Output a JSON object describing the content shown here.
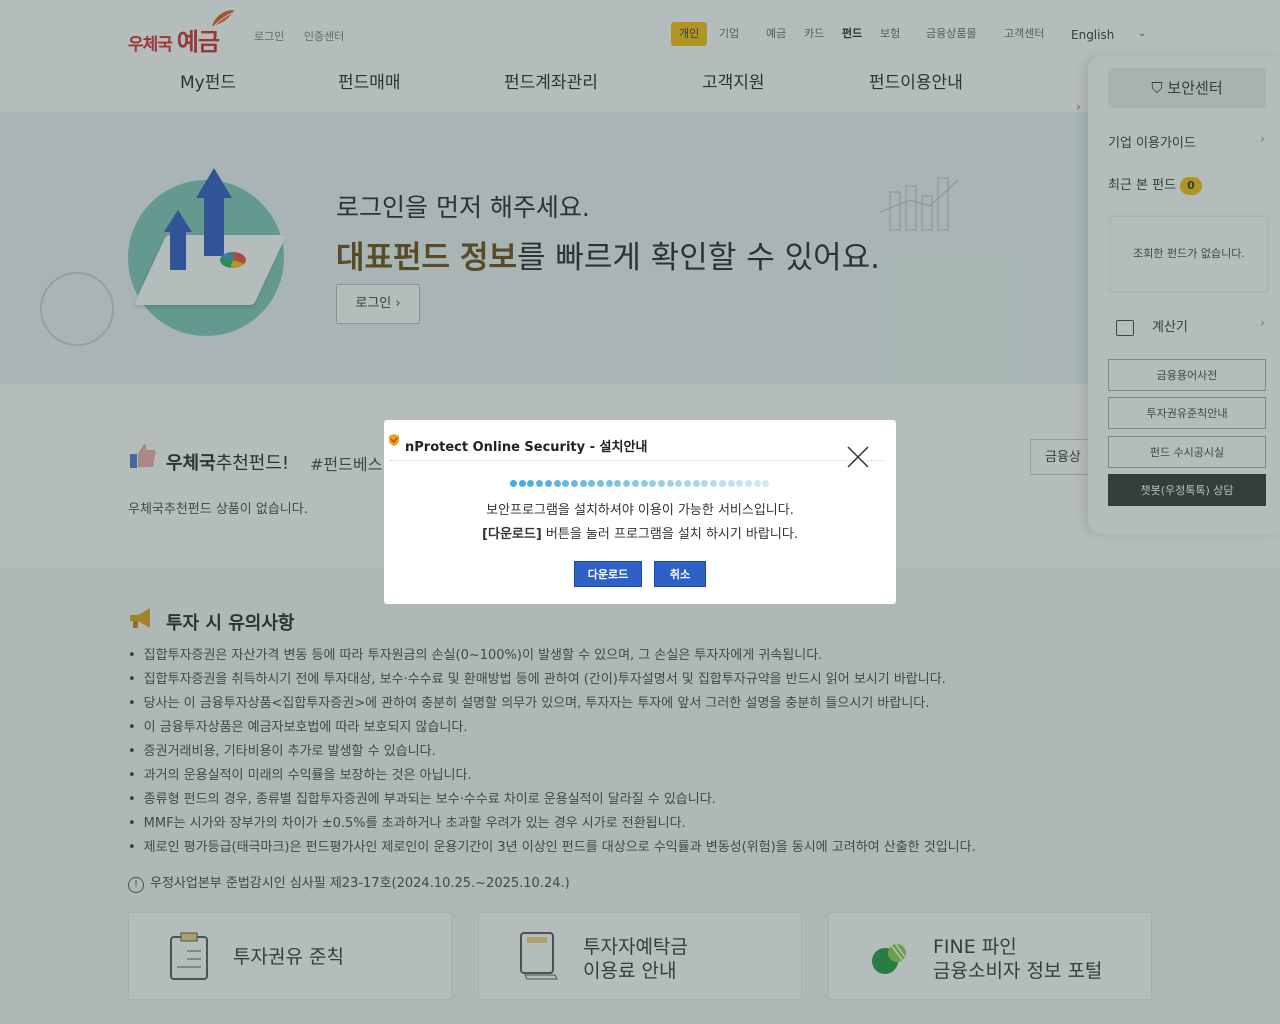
{
  "header": {
    "logo_text": "우체국",
    "logo_bold": "예금",
    "top_links": [
      "로그인",
      "인증센터"
    ],
    "segments": [
      "개인",
      "기업",
      "예금",
      "카드",
      "펀드",
      "보험",
      "금융상품몰",
      "고객센터"
    ],
    "active_segment": "개인",
    "language": "English",
    "accent": "#f7c10a"
  },
  "gnb": [
    "My펀드",
    "펀드매매",
    "펀드계좌관리",
    "고객지원",
    "펀드이용안내"
  ],
  "banner": {
    "line1": "로그인을 먼저 해주세요.",
    "line2_bold1": "대표펀드",
    "line2_bold2": "정보",
    "line2_rest": "를 빠르게 확인할 수 있어요.",
    "login_button": "로그인",
    "bg": "#eaf4f2"
  },
  "recommend": {
    "title_bold": "우체국",
    "title_rest": "추천펀드!",
    "hashtag": "#펀드베스",
    "empty_text": "우체국추천펀드 상품이 없습니다.",
    "side_button": "금융상품"
  },
  "notice": {
    "title": "투자 시 유의사항",
    "items": [
      "집합투자증권은 자산가격 변동 등에 따라 투자원금의 손실(0~100%)이 발생할 수 있으며, 그 손실은 투자자에게 귀속됩니다.",
      "집합투자증권을 취득하시기 전에 투자대상, 보수·수수료 및 환매방법 등에 관하여 (간이)투자설명서 및 집합투자규약을 반드시 읽어 보시기 바랍니다.",
      "당사는 이 금융투자상품<집합투자증권>에 관하여 충분히 설명할 의무가 있으며, 투자자는 투자에 앞서 그러한 설명을 충분히 들으시기 바랍니다.",
      "이 금융투자상품은 예금자보호법에 따라 보호되지 않습니다.",
      "증권거래비용, 기타비용이 추가로 발생할 수 있습니다.",
      "과거의 운용실적이 미래의 수익률을 보장하는 것은 아닙니다.",
      "종류형 펀드의 경우, 종류별 집합투자증권에 부과되는 보수·수수료 차이로 운용실적이 달라질 수 있습니다.",
      "MMF는 시가와 장부가의 차이가 ±0.5%를 초과하거나 초과할 우려가 있는 경우 시가로 전환됩니다.",
      "제로인 평가등급(태극마크)은 펀드평가사인 제로인이 운용기간이 3년 이상인 펀드를 대상으로 수익률과 변동성(위험)을 동시에 고려하여 산출한 것입니다."
    ],
    "review_icon": "!",
    "review": "우정사업본부 준법감시인 심사필 제23-17호(2024.10.25.~2025.10.24.)"
  },
  "cards": [
    {
      "line1": "투자권유 준칙",
      "line2": "",
      "icon": "clipboard-icon"
    },
    {
      "line1": "투자자예탁금",
      "line2": "이용료 안내",
      "icon": "document-icon"
    },
    {
      "line1": "FINE 파인",
      "line2": "금융소비자 정보 포털",
      "icon": "fine-logo-icon"
    }
  ],
  "quick": {
    "security": "보안센터",
    "guide": "기업 이용가이드",
    "recent": "최근 본 펀드",
    "recent_count": "0",
    "recent_empty": "조회한 펀드가 없습니다.",
    "calculator": "계산기",
    "buttons": [
      "금융용어사전",
      "투자권유준칙안내",
      "펀드 수시공시실"
    ],
    "chat_button": "챗봇(우정톡톡) 상담"
  },
  "modal": {
    "title": "nProtect Online Security - 설치안내",
    "line1": "보안프로그램을 설치하셔야 이용이 가능한 서비스입니다.",
    "line2_bold": "[다운로드]",
    "line2_rest": " 버튼을 눌러 프로그램을 설치 하시기 바랍니다.",
    "download": "다운로드",
    "cancel": "취소",
    "button_color": "#2e61c6"
  }
}
